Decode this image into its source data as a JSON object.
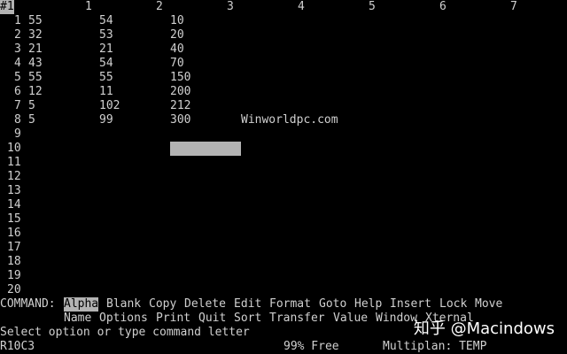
{
  "sheet": {
    "corner_label": "#1",
    "column_headers": [
      "1",
      "2",
      "3",
      "4",
      "5",
      "6",
      "7"
    ],
    "row_headers": [
      "1",
      "2",
      "3",
      "4",
      "5",
      "6",
      "7",
      "8",
      "9",
      "10",
      "11",
      "12",
      "13",
      "14",
      "15",
      "16",
      "17",
      "18",
      "19",
      "20"
    ],
    "cells": [
      {
        "row": 1,
        "col": 1,
        "value": "55"
      },
      {
        "row": 1,
        "col": 2,
        "value": "54"
      },
      {
        "row": 1,
        "col": 3,
        "value": "10"
      },
      {
        "row": 2,
        "col": 1,
        "value": "32"
      },
      {
        "row": 2,
        "col": 2,
        "value": "53"
      },
      {
        "row": 2,
        "col": 3,
        "value": "20"
      },
      {
        "row": 3,
        "col": 1,
        "value": "21"
      },
      {
        "row": 3,
        "col": 2,
        "value": "21"
      },
      {
        "row": 3,
        "col": 3,
        "value": "40"
      },
      {
        "row": 4,
        "col": 1,
        "value": "43"
      },
      {
        "row": 4,
        "col": 2,
        "value": "54"
      },
      {
        "row": 4,
        "col": 3,
        "value": "70"
      },
      {
        "row": 5,
        "col": 1,
        "value": "55"
      },
      {
        "row": 5,
        "col": 2,
        "value": "55"
      },
      {
        "row": 5,
        "col": 3,
        "value": "150"
      },
      {
        "row": 6,
        "col": 1,
        "value": "12"
      },
      {
        "row": 6,
        "col": 2,
        "value": "11"
      },
      {
        "row": 6,
        "col": 3,
        "value": "200"
      },
      {
        "row": 7,
        "col": 1,
        "value": "5"
      },
      {
        "row": 7,
        "col": 2,
        "value": "102"
      },
      {
        "row": 7,
        "col": 3,
        "value": "212"
      },
      {
        "row": 8,
        "col": 1,
        "value": "5"
      },
      {
        "row": 8,
        "col": 2,
        "value": "99"
      },
      {
        "row": 8,
        "col": 3,
        "value": "300"
      },
      {
        "row": 8,
        "col": 4,
        "value": "Winworldpc.com"
      }
    ],
    "active_cell": {
      "row": 10,
      "col": 3
    }
  },
  "command": {
    "prefix": "COMMAND:",
    "line1": [
      "Alpha",
      "Blank",
      "Copy",
      "Delete",
      "Edit",
      "Format",
      "Goto",
      "Help",
      "Insert",
      "Lock",
      "Move"
    ],
    "line2": [
      "Name",
      "Options",
      "Print",
      "Quit",
      "Sort",
      "Transfer",
      "Value",
      "Window",
      "Xternal"
    ],
    "selected": "Alpha",
    "message": "Select option or type command letter"
  },
  "status": {
    "cell_ref": "R10C3",
    "free": "99% Free",
    "app_file": "Multiplan: TEMP"
  },
  "watermark": "知乎 @Macindows"
}
